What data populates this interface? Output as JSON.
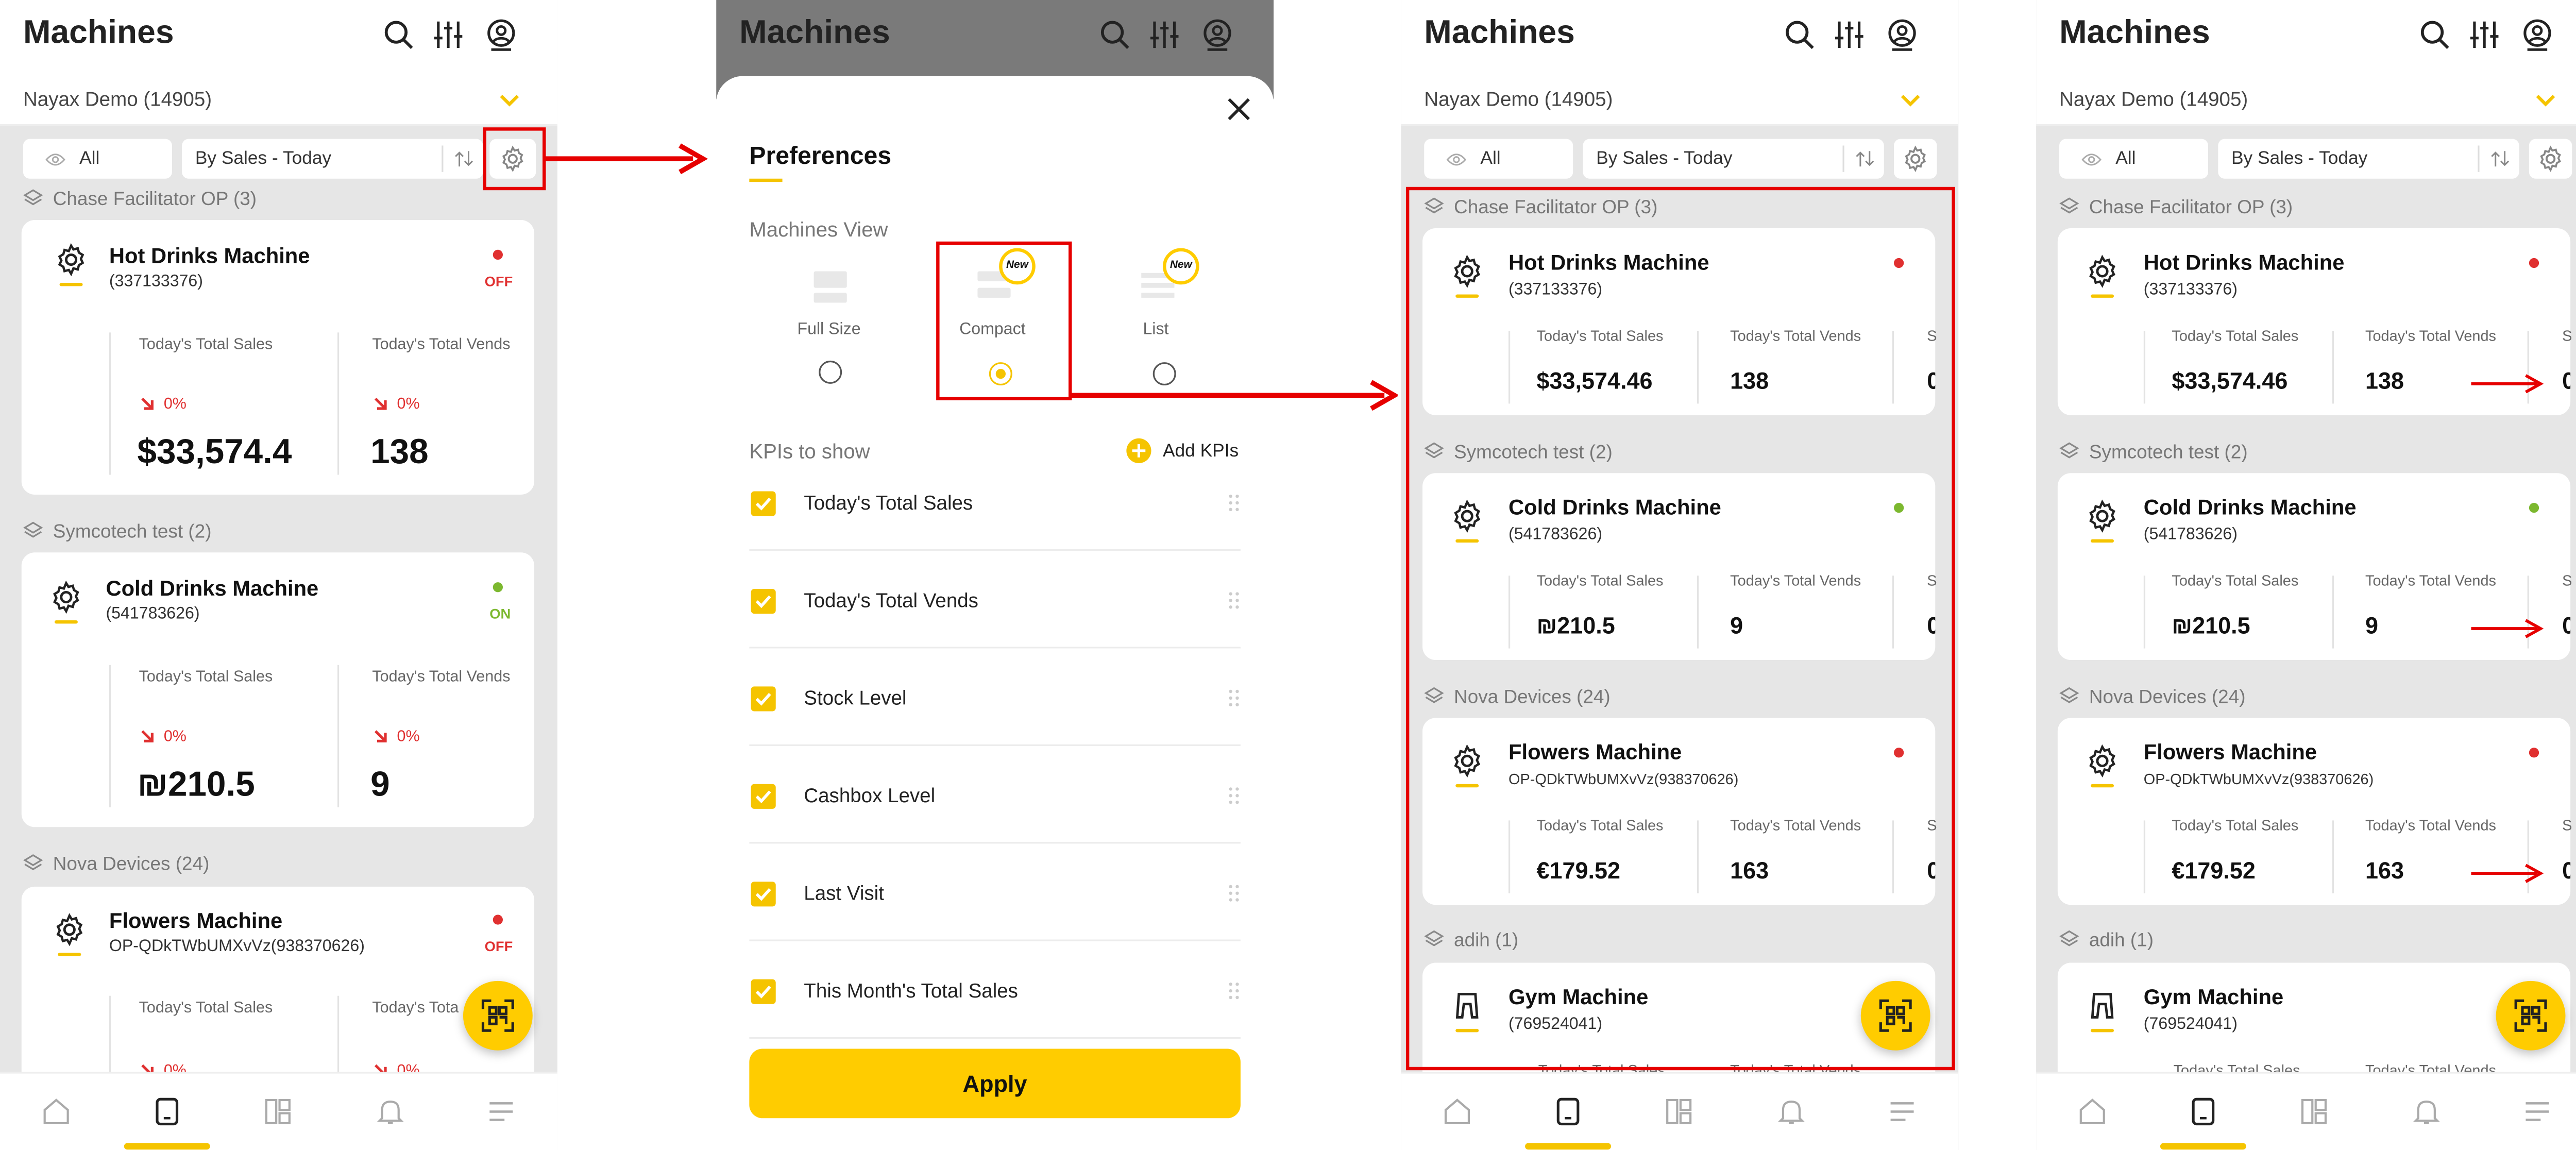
{
  "header": {
    "title": "Machines"
  },
  "account": {
    "name": "Nayax Demo (14905)"
  },
  "filter": {
    "view": "All",
    "sort": "By Sales - Today"
  },
  "groups": {
    "g1": "Chase Facilitator OP (3)",
    "g2": "Symcotech test (2)",
    "g3": "Nova Devices  (24)",
    "g4": "adih (1)"
  },
  "machines": {
    "m1": {
      "name": "Hot Drinks Machine",
      "id": "(337133376)",
      "status": "OFF",
      "sales_full": "$33,574.4",
      "sales": "$33,574.46",
      "vends": "138",
      "pct": "0%"
    },
    "m2": {
      "name": "Cold Drinks Machine",
      "id": "(541783626)",
      "status": "ON",
      "sales": "₪210.5",
      "vends": "9",
      "pct": "0%"
    },
    "m3": {
      "name": "Flowers Machine",
      "id": "OP-QDkTWbUMXvVz(938370626)",
      "status": "OFF",
      "sales": "€179.52",
      "vends": "163",
      "pct": "0%"
    },
    "m4": {
      "name": "Gym Machine",
      "id": "(769524041)"
    }
  },
  "kpi_labels": {
    "sales": "Today's Total Sales",
    "vends": "Today's Total Vends",
    "vends_trunc": "Today's Tota",
    "third_trunc": "S",
    "third_val": "0"
  },
  "preferences": {
    "title": "Preferences",
    "view_label": "Machines View",
    "options": [
      "Full Size",
      "Compact",
      "List"
    ],
    "new_badge": "New",
    "kpis_label": "KPIs to show",
    "add_kpis": "Add KPIs",
    "kpis": [
      "Today's Total Sales",
      "Today's Total Vends",
      "Stock Level",
      "Cashbox Level",
      "Last Visit",
      "This Month's Total Sales"
    ],
    "apply": "Apply"
  },
  "colors": {
    "accent": "#FFCC00",
    "annotation": "#E60000",
    "off": "#E03030",
    "on": "#7CB82F"
  },
  "icons": [
    "search-icon",
    "filter-sliders-icon",
    "user-location-icon",
    "chevron-down-icon",
    "eye-icon",
    "sort-icon",
    "gear-icon",
    "layers-icon",
    "home-icon",
    "tablet-icon",
    "dashboard-icon",
    "bell-icon",
    "menu-icon",
    "scan-icon",
    "close-icon",
    "plus-icon",
    "drag-handle-icon"
  ]
}
